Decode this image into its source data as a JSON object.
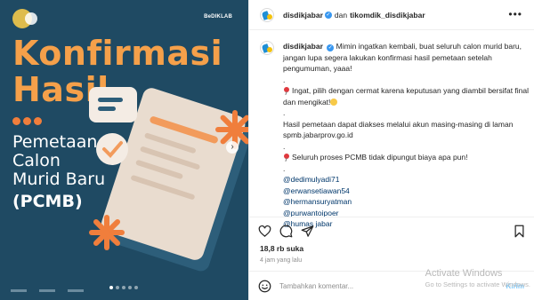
{
  "image": {
    "logo_text": "BeDIKLAB",
    "title_line1": "Konfirmasi",
    "title_line2": "Hasil",
    "subtitle_lines": [
      "Pemetaan",
      "Calon",
      "Murid Baru"
    ],
    "subtitle_bold": "(PCMB)",
    "colors": {
      "background": "#1f4a63",
      "accent": "#f5a04a",
      "dots": "#f07e3c"
    },
    "carousel": {
      "current_slide": 1,
      "total_slides": 5
    }
  },
  "header": {
    "username": "disdikjabar",
    "connector": "dan",
    "collaborator": "tikomdik_disdikjabar",
    "verified": true
  },
  "caption": {
    "username": "disdikjabar",
    "text1": "Mimin ingatkan kembali, buat seluruh calon murid baru, jangan lupa segera lakukan konfirmasi hasil pemetaan setelah pengumuman, yaaa!",
    "dot1": ".",
    "text2": "Ingat, pilih dengan cermat karena keputusan yang diambil bersifat final dan mengikat!",
    "dot2": ".",
    "text3": "Hasil pemetaan dapat diakses melalui akun masing-masing di laman spmb.jabarprov.go.id",
    "dot3": ".",
    "text4": "Seluruh proses PCMB tidak dipungut biaya apa pun!",
    "dot4": ".",
    "mentions": [
      "@dedimulyadi71",
      "@erwansetiawan54",
      "@hermansuryatman",
      "@purwantoipoer",
      "@humas jabar"
    ]
  },
  "stats": {
    "likes": "18,8 rb suka",
    "time_ago": "4 jam yang lalu"
  },
  "comment": {
    "placeholder": "Tambahkan komentar...",
    "post_label": "Kirim"
  },
  "watermark": {
    "line1": "Activate Windows",
    "line2": "Go to Settings to activate Windows."
  },
  "icons": {
    "like": "heart-icon",
    "comment": "comment-icon",
    "share": "share-icon",
    "save": "bookmark-icon",
    "more": "more-options-icon",
    "emoji": "emoji-icon"
  }
}
